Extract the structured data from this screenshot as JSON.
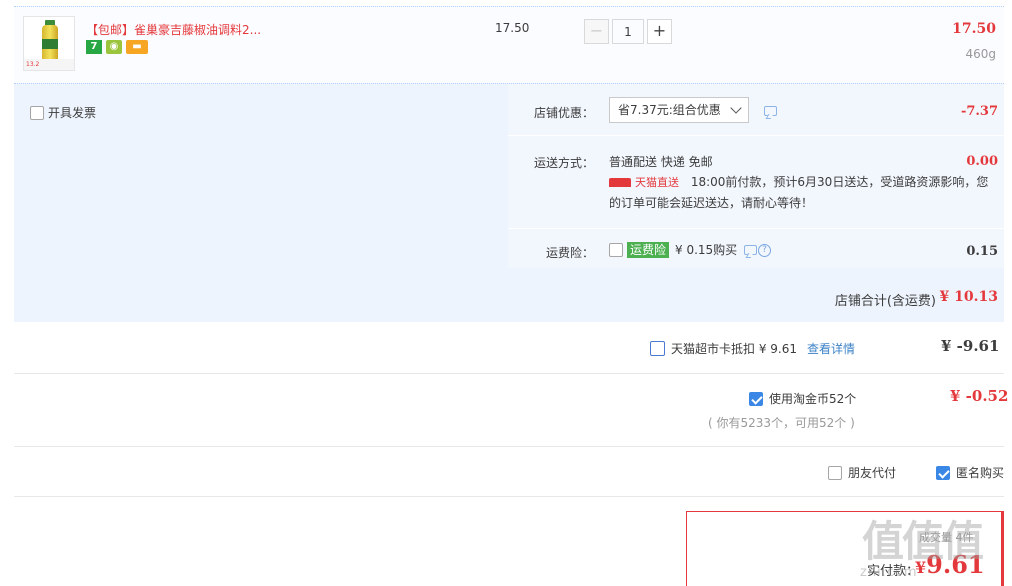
{
  "product": {
    "title": "【包邮】雀巢豪吉藤椒油调料2...",
    "thumb_tag": "13.2",
    "unit_price": "17.50",
    "quantity": "1",
    "minus_label": "−",
    "plus_label": "+",
    "line_total": "17.50",
    "weight": "460g",
    "promo_icons": [
      "7-icon",
      "green-badge-icon",
      "card-icon"
    ]
  },
  "invoice": {
    "label": "开具发票"
  },
  "shop_discount": {
    "label": "店铺优惠：",
    "selected": "省7.37元:组合优惠",
    "amount": "-7.37"
  },
  "shipping": {
    "label": "运送方式：",
    "method": "普通配送 快递 免邮",
    "tmall_label": "天猫直送",
    "notice": "18:00前付款，预计6月30日送达，受道路资源影响，您的订单可能会延迟送达，请耐心等待！",
    "amount": "0.00"
  },
  "insurance": {
    "label": "运费险：",
    "badge": "运费险",
    "price_text": "¥ 0.15购买",
    "amount": "0.15"
  },
  "shop_total": {
    "label": "店铺合计(含运费)",
    "amount": "¥ 10.13"
  },
  "supermarket_card": {
    "label": "天猫超市卡抵扣 ¥ 9.61",
    "link": "查看详情",
    "amount": "¥ -9.61"
  },
  "taojinbi": {
    "label": "使用淘金币52个",
    "note": "( 你有5233个，可用52个 )",
    "amount": "¥ -0.52"
  },
  "options": {
    "friend_pay": "朋友代付",
    "anonymous": "匿名购买"
  },
  "summary": {
    "pay_label": "实付款：",
    "pay_yen": "¥",
    "pay_amount": "9.61",
    "deal_count": "成交量 4件"
  },
  "watermark": {
    "text": "值值值",
    "url": "zhi.com"
  },
  "colors": {
    "accent_red": "#e4393c",
    "panel_blue": "#eef4fd",
    "check_blue": "#3b87e6"
  }
}
